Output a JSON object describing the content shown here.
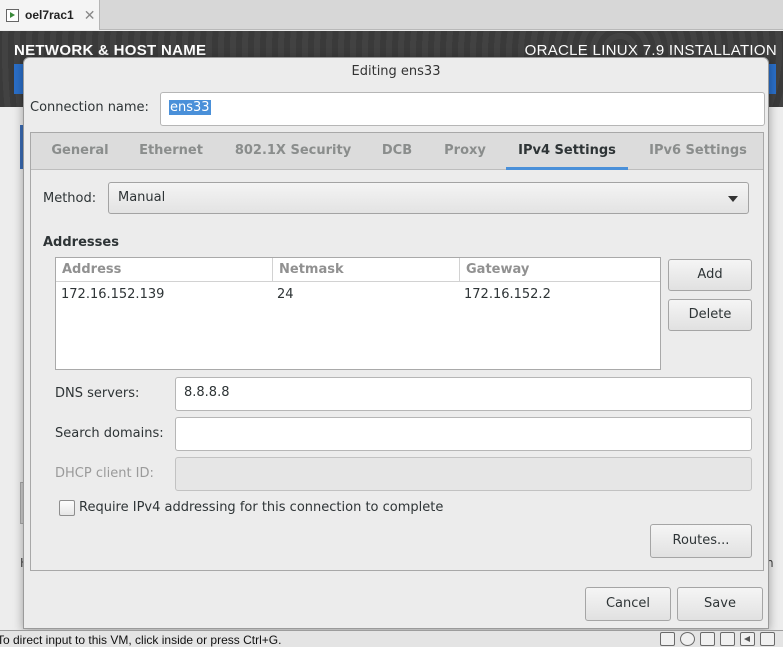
{
  "vm": {
    "tab_title": "oel7rac1",
    "tab_close": "✕",
    "status_text": "To direct input to this VM, click inside or press Ctrl+G."
  },
  "anaconda": {
    "spoke_title": "NETWORK & HOST NAME",
    "product_title": "ORACLE LINUX 7.9 INSTALLATION",
    "bg_letter_left": "H",
    "bg_letter_right": "n"
  },
  "dialog": {
    "title": "Editing ens33",
    "connection_label": "Connection name:",
    "connection_value": "ens33",
    "tabs": [
      {
        "label": "General"
      },
      {
        "label": "Ethernet"
      },
      {
        "label": "802.1X Security"
      },
      {
        "label": "DCB"
      },
      {
        "label": "Proxy"
      },
      {
        "label": "IPv4 Settings",
        "active": true
      },
      {
        "label": "IPv6 Settings"
      }
    ],
    "method_label": "Method:",
    "method_value": "Manual",
    "addresses_heading": "Addresses",
    "addresses": {
      "columns": [
        "Address",
        "Netmask",
        "Gateway"
      ],
      "rows": [
        [
          "172.16.152.139",
          "24",
          "172.16.152.2"
        ]
      ]
    },
    "add_label": "Add",
    "delete_label": "Delete",
    "dns_label": "DNS servers:",
    "dns_value": "8.8.8.8",
    "search_domains_label": "Search domains:",
    "search_domains_value": "",
    "dhcp_client_id_label": "DHCP client ID:",
    "dhcp_client_id_value": "",
    "require_ipv4_label": "Require IPv4 addressing for this connection to complete",
    "require_ipv4_checked": false,
    "routes_label": "Routes...",
    "cancel_label": "Cancel",
    "save_label": "Save"
  }
}
